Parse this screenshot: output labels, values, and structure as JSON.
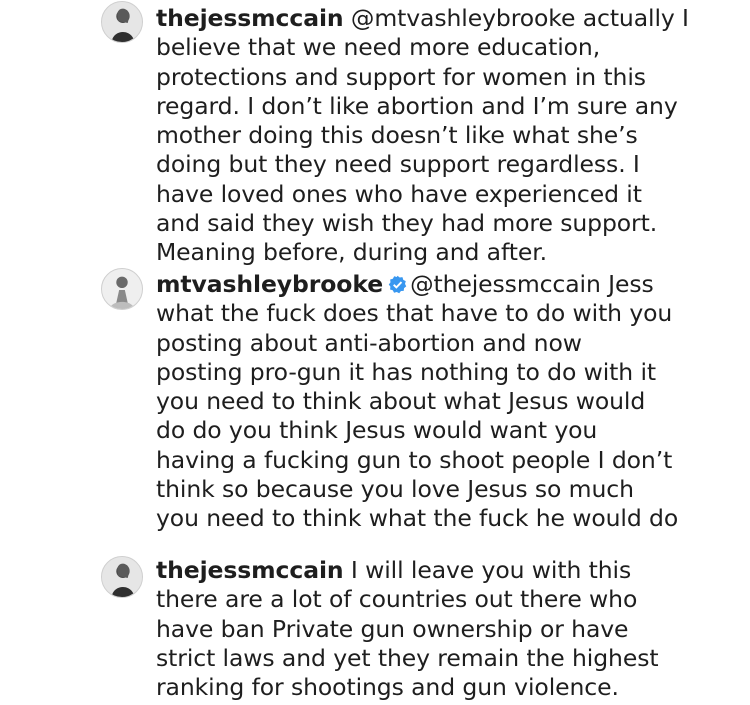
{
  "comments": [
    {
      "username": "thejessmccain",
      "verified": false,
      "avatar_icon": "profile-photo-icon",
      "lines": [
        " @mtvashleybrooke actually I",
        "believe that we need more education,",
        "protections and support for women in this",
        "regard. I don’t like abortion and I’m sure any",
        "mother doing this doesn’t like what she’s",
        "doing but they need support regardless. I",
        "have loved ones who have experienced it",
        "and said they wish they had more support.",
        "Meaning before, during and after."
      ]
    },
    {
      "username": "mtvashleybrooke",
      "verified": true,
      "avatar_icon": "profile-photo-icon",
      "lines": [
        "@thejessmccain Jess",
        "what the fuck does that have to do with you",
        "posting about anti-abortion and now",
        "posting pro-gun it has nothing to do with it",
        "you need to think about what Jesus would",
        "do do you think Jesus would want you",
        "having a fucking gun to shoot people I don’t",
        "think so because you love Jesus so much",
        "you need to think what the fuck he would do"
      ]
    },
    {
      "username": "thejessmccain",
      "verified": false,
      "avatar_icon": "profile-photo-icon",
      "lines": [
        " I will leave you with this",
        "there are a lot of countries out there who",
        "have ban Private gun ownership or have",
        "strict laws and yet they remain the highest",
        "ranking for shootings and gun violence."
      ]
    }
  ],
  "colors": {
    "text": "#1e1e1e",
    "verified_badge": "#3897f0",
    "background": "#ffffff"
  }
}
